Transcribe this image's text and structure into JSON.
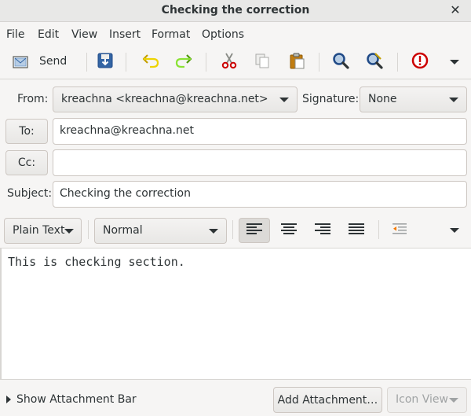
{
  "window": {
    "title": "Checking the correction"
  },
  "menu": [
    "File",
    "Edit",
    "View",
    "Insert",
    "Format",
    "Options"
  ],
  "toolbar": {
    "send_label": "Send"
  },
  "header": {
    "from_label": "From:",
    "from_value": "kreachna <kreachna@kreachna.net>",
    "signature_label": "Signature:",
    "signature_value": "None",
    "to_label": "To:",
    "to_value": "kreachna@kreachna.net",
    "cc_label": "Cc:",
    "cc_value": "",
    "subject_label": "Subject:",
    "subject_value": "Checking the correction"
  },
  "format": {
    "mode": "Plain Text",
    "paragraph_style": "Normal"
  },
  "body": {
    "text": "This is checking section."
  },
  "bottom": {
    "show_attachment_bar": "Show Attachment Bar",
    "add_attachment": "Add Attachment…",
    "icon_view": "Icon View"
  },
  "colors": {
    "background": "#f6f5f4",
    "titlebar": "#e8e8e7",
    "border": "#cdc7c2",
    "urgent_red": "#cc0000",
    "search_blue": "#204a87"
  }
}
